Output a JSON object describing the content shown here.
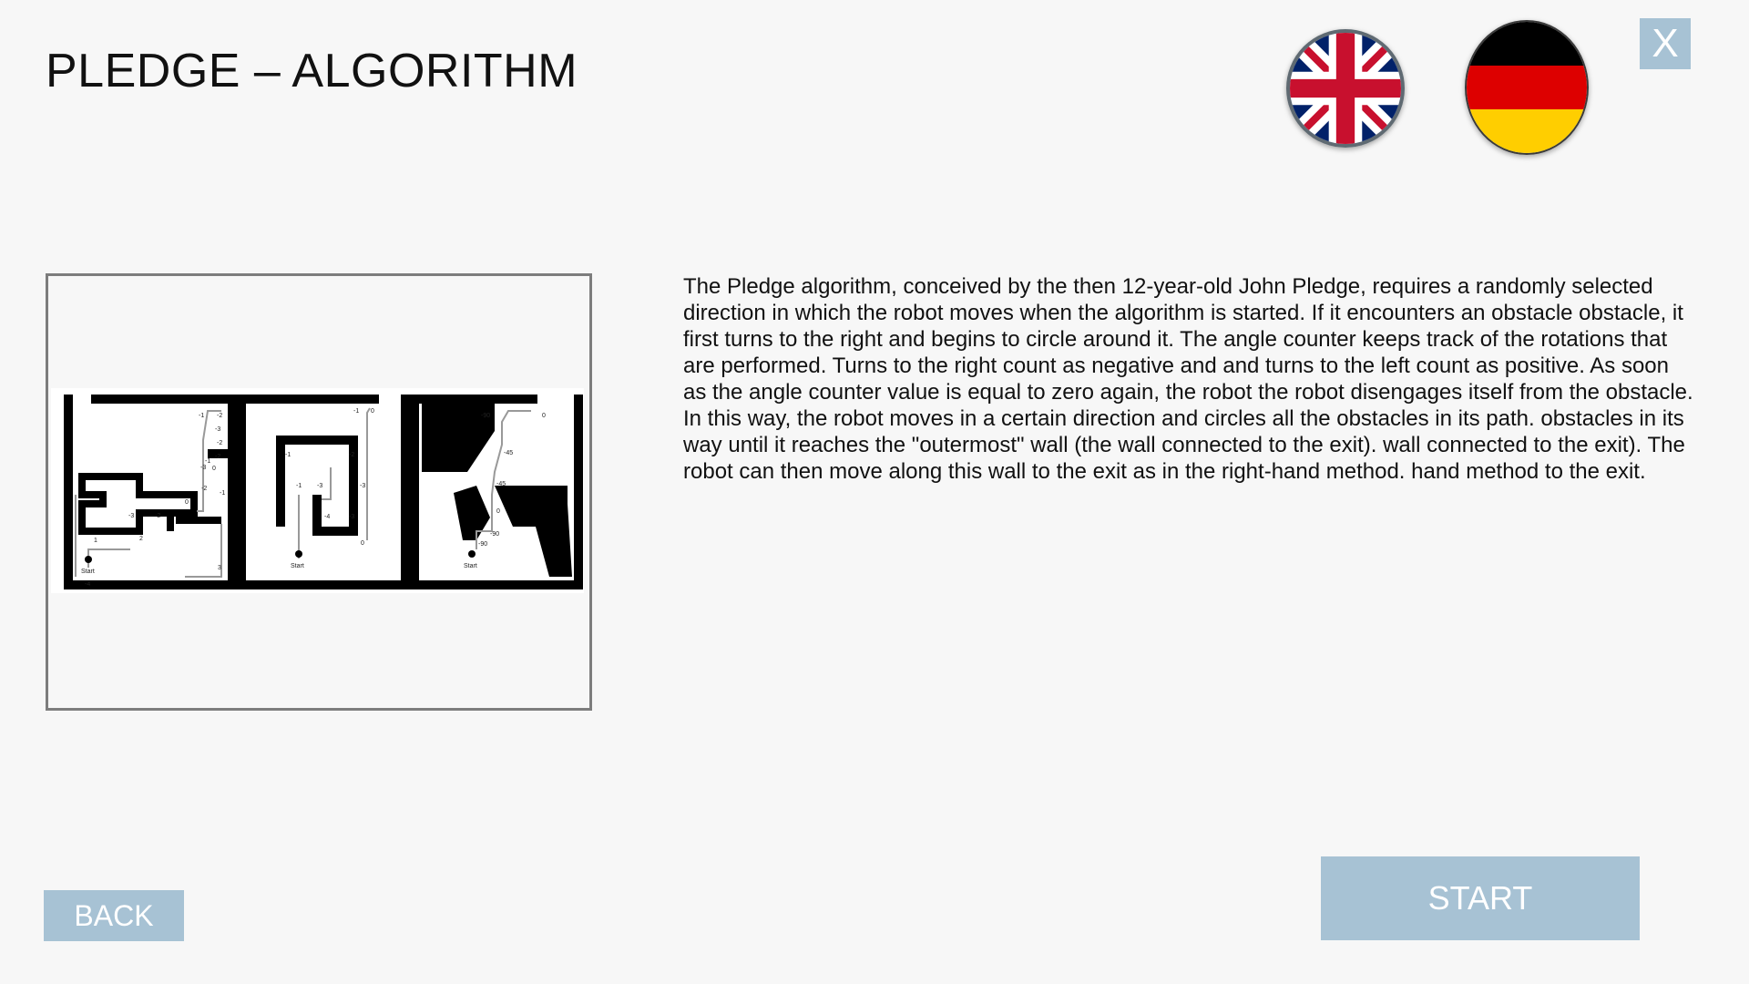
{
  "window": {
    "title": "PLEDGE – ALGORITHM",
    "close_label": "X"
  },
  "languages": [
    {
      "name": "flag-uk-icon",
      "label": "English"
    },
    {
      "name": "flag-de-icon",
      "label": "German"
    }
  ],
  "figure": {
    "icon": "pledge-algorithm-maze-diagram",
    "start_label": "Start",
    "maze1_labels": [
      "-1",
      "-2",
      "-3",
      "-2",
      "-2",
      "-1",
      "-3",
      "0",
      "-2",
      "-1",
      "0",
      "-2",
      "-3",
      "-4",
      "1",
      "2",
      "3"
    ],
    "maze2_labels": [
      "-1",
      "0",
      "-1",
      "-2",
      "-3",
      "-1",
      "-3",
      "-4",
      "-3",
      "0"
    ],
    "maze3_labels": [
      "-90",
      "0",
      "-45",
      "-45",
      "0",
      "-90",
      "-90"
    ]
  },
  "description": "The Pledge algorithm, conceived by the then 12-year-old John Pledge, requires a randomly selected direction in which the robot moves when the algorithm is started. If it encounters an obstacle obstacle, it first turns to the right and begins to circle around it. The angle counter keeps track of the rotations that are performed. Turns to the right count as negative and and turns to the left count as positive. As soon as the angle counter value is equal to zero again, the robot the robot disengages itself from the obstacle. In this way, the robot moves in a certain direction and circles all the obstacles in its path. obstacles in its way until it reaches the \"outermost\" wall (the wall connected to the exit). wall connected to the exit). The robot can then move along this wall to the exit as in the right-hand method. hand method to the exit.",
  "buttons": {
    "back_label": "BACK",
    "start_label": "START"
  },
  "colors": {
    "button_bg": "#a7c2d4",
    "page_bg": "#f7f7f7"
  }
}
